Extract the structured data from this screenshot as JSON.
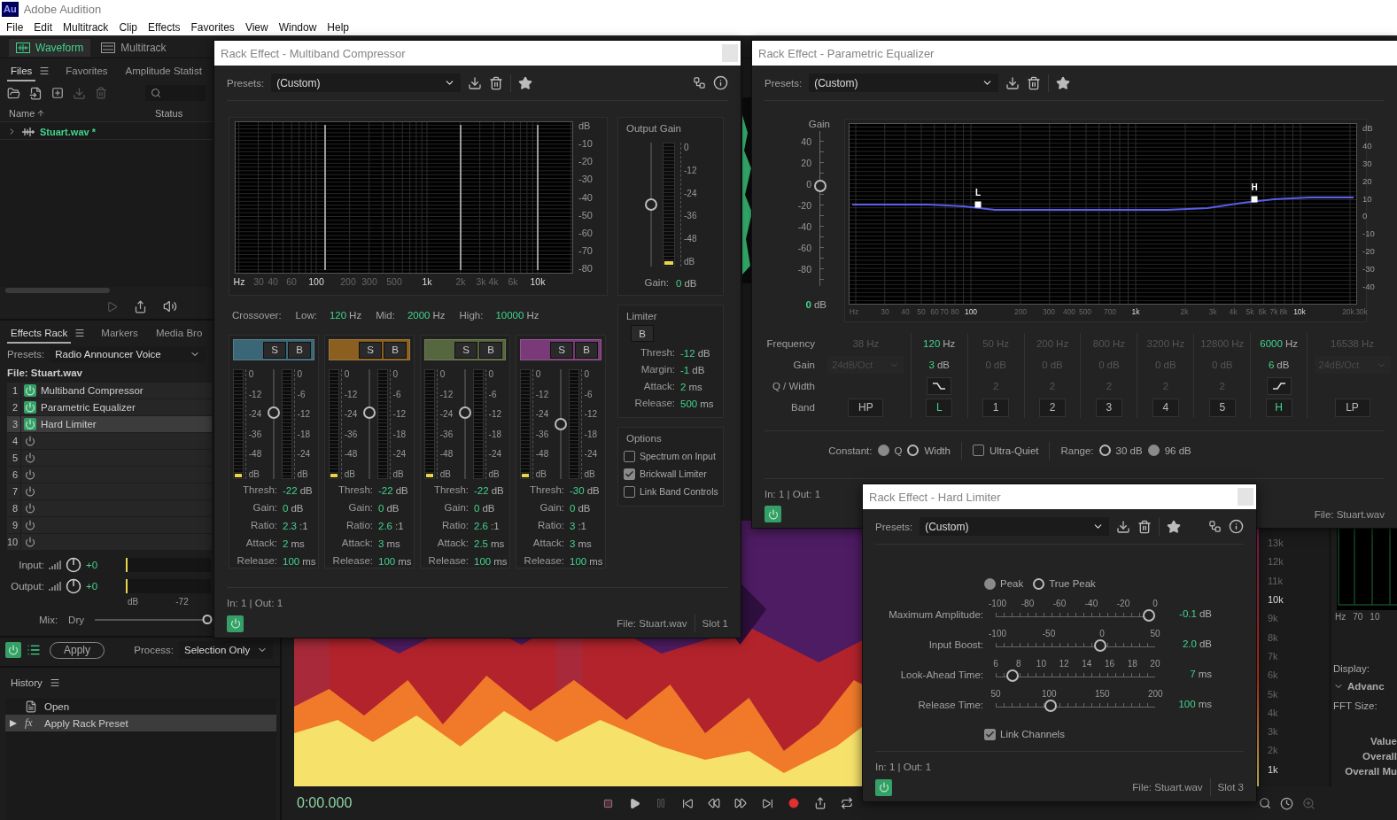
{
  "app": {
    "logo": "Au",
    "title": "Adobe Audition"
  },
  "menu": [
    "File",
    "Edit",
    "Multitrack",
    "Clip",
    "Effects",
    "Favorites",
    "View",
    "Window",
    "Help"
  ],
  "workspace_tabs": [
    {
      "label": "Waveform",
      "selected": true
    },
    {
      "label": "Multitrack",
      "selected": false
    }
  ],
  "files_panel": {
    "tabs": [
      {
        "label": "Files",
        "selected": true
      },
      {
        "label": "Favorites",
        "selected": false
      },
      {
        "label": "Amplitude Statist",
        "selected": false
      }
    ],
    "columns": [
      "Name",
      "Status"
    ],
    "files": [
      {
        "name": "Stuart.wav *",
        "expanded": false
      }
    ]
  },
  "effects_rack": {
    "tabs": [
      {
        "label": "Effects Rack",
        "selected": true
      },
      {
        "label": "Markers",
        "selected": false
      },
      {
        "label": "Media Bro",
        "selected": false
      }
    ],
    "presets_label": "Presets:",
    "preset": "Radio Announcer Voice",
    "file": "File: Stuart.wav",
    "slots": [
      {
        "number": "1",
        "name": "Multiband Compressor",
        "on": true,
        "selected": false
      },
      {
        "number": "2",
        "name": "Parametric Equalizer",
        "on": true,
        "selected": false
      },
      {
        "number": "3",
        "name": "Hard Limiter",
        "on": true,
        "selected": true
      },
      {
        "number": "4",
        "on": false,
        "selected": false
      },
      {
        "number": "5",
        "on": false,
        "selected": false
      },
      {
        "number": "6",
        "on": false,
        "selected": false
      },
      {
        "number": "7",
        "on": false,
        "selected": false
      },
      {
        "number": "8",
        "on": false,
        "selected": false
      },
      {
        "number": "9",
        "on": false,
        "selected": false
      },
      {
        "number": "10",
        "on": false,
        "selected": false
      }
    ],
    "io": [
      {
        "label": "Input:",
        "value": "+0"
      },
      {
        "label": "Output:",
        "value": "+0"
      }
    ],
    "meter_scale": [
      "dB",
      "-72"
    ],
    "mix": {
      "label": "Mix:",
      "left": "Dry",
      "level": 1
    },
    "apply": "Apply",
    "process_label": "Process:",
    "process": "Selection Only"
  },
  "history": {
    "title": "History",
    "items": [
      {
        "label": "Open",
        "selected": false
      },
      {
        "label": "Apply Rack Preset",
        "badge": "fx",
        "selected": true
      }
    ]
  },
  "editor": {
    "time": "0:00.000",
    "frequency_labels": [
      {
        "label": "13k",
        "major": false
      },
      {
        "label": "12k",
        "major": false
      },
      {
        "label": "11k",
        "major": false
      },
      {
        "label": "10k",
        "major": true
      },
      {
        "label": "9k",
        "major": false
      },
      {
        "label": "8k",
        "major": false
      },
      {
        "label": "7k",
        "major": false
      },
      {
        "label": "6k",
        "major": false
      },
      {
        "label": "5k",
        "major": false
      },
      {
        "label": "4k",
        "major": false
      },
      {
        "label": "3k",
        "major": false
      },
      {
        "label": "2k",
        "major": false
      },
      {
        "label": "1k",
        "major": true
      }
    ],
    "right_panel": {
      "axis": [
        "Hz",
        "70",
        "10"
      ],
      "display_label": "Display:",
      "advanced": "Advanc",
      "fft_label": "FFT Size:",
      "labels": [
        "Value",
        "Overall",
        "Overall Mu"
      ]
    }
  },
  "multiband_compressor": {
    "title": "Rack Effect - Multiband Compressor",
    "presets_label": "Presets:",
    "preset": "(Custom)",
    "spectrum": {
      "db_labels": [
        "dB",
        "-10",
        "-20",
        "-30",
        "-40",
        "-50",
        "-60",
        "-70",
        "-80"
      ],
      "hz_labels": [
        {
          "label": "Hz",
          "major": true
        },
        {
          "label": "30",
          "major": false
        },
        {
          "label": "40",
          "major": false
        },
        {
          "label": "60",
          "major": false
        },
        {
          "label": "100",
          "major": true
        },
        {
          "label": "200",
          "major": false
        },
        {
          "label": "300",
          "major": false
        },
        {
          "label": "500",
          "major": false
        },
        {
          "label": "1k",
          "major": true
        },
        {
          "label": "2k",
          "major": false
        },
        {
          "label": "3k",
          "major": false
        },
        {
          "label": "4k",
          "major": false
        },
        {
          "label": "6k",
          "major": false
        },
        {
          "label": "10k",
          "major": true
        }
      ]
    },
    "output_gain": {
      "title": "Output Gain",
      "scale": [
        "0",
        "-12",
        "-24",
        "-36",
        "-48",
        "dB"
      ],
      "level": 0.5,
      "meter": {
        "level": 0.03
      },
      "gain_label": "Gain:",
      "gain": "0",
      "unit": "dB"
    },
    "crossover": {
      "label": "Crossover:",
      "points": [
        {
          "label": "Low:",
          "value": "120",
          "unit": "Hz"
        },
        {
          "label": "Mid:",
          "value": "2000",
          "unit": "Hz"
        },
        {
          "label": "High:",
          "value": "10000",
          "unit": "Hz"
        }
      ]
    },
    "bands": [
      {
        "color": "#3b6676",
        "solo": "S",
        "bypass": "B",
        "level": 0.62,
        "meter": {
          "level": 0.03
        },
        "input_scale": [
          "0",
          "-12",
          "-24",
          "-36",
          "-48",
          "dB"
        ],
        "gain_scale": [
          "0",
          "-6",
          "-12",
          "-18",
          "-24",
          "dB"
        ],
        "params": [
          {
            "label": "Thresh:",
            "value": "-22",
            "unit": "dB"
          },
          {
            "label": "Gain:",
            "value": "0",
            "unit": "dB"
          },
          {
            "label": "Ratio:",
            "value": "2.3",
            "unit": ":1"
          },
          {
            "label": "Attack:",
            "value": "2",
            "unit": "ms"
          },
          {
            "label": "Release:",
            "value": "100",
            "unit": "ms"
          }
        ]
      },
      {
        "color": "#8a5f1f",
        "solo": "S",
        "bypass": "B",
        "level": 0.62,
        "meter": {
          "level": 0.03
        },
        "input_scale": [
          "0",
          "-12",
          "-24",
          "-36",
          "-48",
          "dB"
        ],
        "gain_scale": [
          "0",
          "-6",
          "-12",
          "-18",
          "-24",
          "dB"
        ],
        "params": [
          {
            "label": "Thresh:",
            "value": "-22",
            "unit": "dB"
          },
          {
            "label": "Gain:",
            "value": "0",
            "unit": "dB"
          },
          {
            "label": "Ratio:",
            "value": "2.6",
            "unit": ":1"
          },
          {
            "label": "Attack:",
            "value": "3",
            "unit": "ms"
          },
          {
            "label": "Release:",
            "value": "100",
            "unit": "ms"
          }
        ]
      },
      {
        "color": "#56663f",
        "solo": "S",
        "bypass": "B",
        "level": 0.62,
        "meter": {
          "level": 0.03
        },
        "input_scale": [
          "0",
          "-12",
          "-24",
          "-36",
          "-48",
          "dB"
        ],
        "gain_scale": [
          "0",
          "-6",
          "-12",
          "-18",
          "-24",
          "dB"
        ],
        "params": [
          {
            "label": "Thresh:",
            "value": "-22",
            "unit": "dB"
          },
          {
            "label": "Gain:",
            "value": "0",
            "unit": "dB"
          },
          {
            "label": "Ratio:",
            "value": "2.6",
            "unit": ":1"
          },
          {
            "label": "Attack:",
            "value": "2.5",
            "unit": "ms"
          },
          {
            "label": "Release:",
            "value": "100",
            "unit": "ms"
          }
        ]
      },
      {
        "color": "#7a3a79",
        "solo": "S",
        "bypass": "B",
        "level": 0.5,
        "meter": {
          "level": 0.03
        },
        "input_scale": [
          "0",
          "-12",
          "-24",
          "-36",
          "-48",
          "dB"
        ],
        "gain_scale": [
          "0",
          "-6",
          "-12",
          "-18",
          "-24",
          "dB"
        ],
        "params": [
          {
            "label": "Thresh:",
            "value": "-30",
            "unit": "dB"
          },
          {
            "label": "Gain:",
            "value": "0",
            "unit": "dB"
          },
          {
            "label": "Ratio:",
            "value": "3",
            "unit": ":1"
          },
          {
            "label": "Attack:",
            "value": "3",
            "unit": "ms"
          },
          {
            "label": "Release:",
            "value": "100",
            "unit": "ms"
          }
        ]
      }
    ],
    "limiter": {
      "title": "Limiter",
      "bypass": "B",
      "params": [
        {
          "label": "Thresh:",
          "value": "-12",
          "unit": "dB"
        },
        {
          "label": "Margin:",
          "value": "-1",
          "unit": "dB"
        },
        {
          "label": "Attack:",
          "value": "2",
          "unit": "ms"
        },
        {
          "label": "Release:",
          "value": "500",
          "unit": "ms"
        }
      ]
    },
    "options": {
      "title": "Options",
      "items": [
        {
          "label": "Spectrum on Input",
          "checked": false
        },
        {
          "label": "Brickwall Limiter",
          "checked": true
        },
        {
          "label": "Link Band Controls",
          "checked": false
        }
      ]
    },
    "footer": {
      "io": "In: 1 | Out: 1",
      "power": true,
      "file": "File: Stuart.wav",
      "slot": "Slot 1"
    }
  },
  "parametric_equalizer": {
    "title": "Rack Effect - Parametric Equalizer",
    "presets_label": "Presets:",
    "preset": "(Custom)",
    "gain_axis": {
      "title": "Gain",
      "labels": [
        "40",
        "20",
        "0",
        "-20",
        "-40",
        "-60",
        "-80"
      ],
      "level": 0.66,
      "value": "0",
      "unit": "dB"
    },
    "graph": {
      "db_labels": [
        "dB",
        "40",
        "30",
        "20",
        "10",
        "0",
        "-10",
        "-20",
        "-30",
        "-40"
      ],
      "hz_labels": [
        {
          "label": "Hz",
          "major": false
        },
        {
          "label": "30",
          "major": false
        },
        {
          "label": "40",
          "major": false
        },
        {
          "label": "50",
          "major": false
        },
        {
          "label": "60",
          "major": false
        },
        {
          "label": "70",
          "major": false
        },
        {
          "label": "80",
          "major": false
        },
        {
          "label": "100",
          "major": true
        },
        {
          "label": "200",
          "major": false
        },
        {
          "label": "300",
          "major": false
        },
        {
          "label": "400",
          "major": false
        },
        {
          "label": "500",
          "major": false
        },
        {
          "label": "700",
          "major": false
        },
        {
          "label": "1k",
          "major": true
        },
        {
          "label": "2k",
          "major": false
        },
        {
          "label": "3k",
          "major": false
        },
        {
          "label": "4k",
          "major": false
        },
        {
          "label": "5k",
          "major": false
        },
        {
          "label": "6k",
          "major": false
        },
        {
          "label": "7k",
          "major": false
        },
        {
          "label": "8k",
          "major": false
        },
        {
          "label": "10k",
          "major": true
        },
        {
          "label": "20k",
          "major": false
        },
        {
          "label": "30k",
          "major": false
        }
      ],
      "markers": [
        "L",
        "H"
      ]
    },
    "row_labels": [
      "Frequency",
      "Gain",
      "Q / Width",
      "Band"
    ],
    "bands": [
      {
        "kind": "pass",
        "frequency": "38",
        "unit": "Hz",
        "slope": "24dB/Oct",
        "button": "HP",
        "enabled": false
      },
      {
        "kind": "low_shelf",
        "frequency": "120",
        "unit": "Hz",
        "gain": "3",
        "gain_unit": "dB",
        "button": "L",
        "enabled": true
      },
      {
        "kind": "peak",
        "frequency": "50",
        "unit": "Hz",
        "gain": "0",
        "gain_unit": "dB",
        "q": "2",
        "button": "1",
        "enabled": false
      },
      {
        "kind": "peak",
        "frequency": "200",
        "unit": "Hz",
        "gain": "0",
        "gain_unit": "dB",
        "q": "2",
        "button": "2",
        "enabled": false
      },
      {
        "kind": "peak",
        "frequency": "800",
        "unit": "Hz",
        "gain": "0",
        "gain_unit": "dB",
        "q": "2",
        "button": "3",
        "enabled": false
      },
      {
        "kind": "peak",
        "frequency": "3200",
        "unit": "Hz",
        "gain": "0",
        "gain_unit": "dB",
        "q": "2",
        "button": "4",
        "enabled": false
      },
      {
        "kind": "peak",
        "frequency": "12800",
        "unit": "Hz",
        "gain": "0",
        "gain_unit": "dB",
        "q": "2",
        "button": "5",
        "enabled": false
      },
      {
        "kind": "high_shelf",
        "frequency": "6000",
        "unit": "Hz",
        "gain": "6",
        "gain_unit": "dB",
        "button": "H",
        "enabled": true
      },
      {
        "kind": "pass",
        "frequency": "16538",
        "unit": "Hz",
        "slope": "24dB/Oct",
        "button": "LP",
        "enabled": false
      }
    ],
    "constant": {
      "label": "Constant:",
      "options": [
        {
          "label": "Q",
          "selected": true
        },
        {
          "label": "Width",
          "selected": false
        }
      ]
    },
    "ultra_quiet": {
      "label": "Ultra-Quiet",
      "checked": false
    },
    "range": {
      "label": "Range:",
      "options": [
        {
          "label": "30 dB",
          "selected": false
        },
        {
          "label": "96 dB",
          "selected": true
        }
      ]
    },
    "footer": {
      "io": "In: 1 | Out: 1",
      "power": true,
      "file": "File: Stuart.wav"
    }
  },
  "hard_limiter": {
    "title": "Rack Effect - Hard Limiter",
    "presets_label": "Presets:",
    "preset": "(Custom)",
    "modes": [
      {
        "label": "Peak",
        "selected": true
      },
      {
        "label": "True Peak",
        "selected": false
      }
    ],
    "sliders": [
      {
        "label": "Maximum Amplitude:",
        "ticks": [
          "-100",
          "-80",
          "-60",
          "-40",
          "-20",
          "0"
        ],
        "level": 1,
        "value": "-0.1",
        "unit": "dB"
      },
      {
        "label": "Input Boost:",
        "ticks": [
          "-100",
          "-50",
          "0",
          "50"
        ],
        "level": 0.667,
        "value": "2.0",
        "unit": "dB"
      },
      {
        "label": "Look-Ahead Time:",
        "ticks": [
          "6",
          "8",
          "10",
          "12",
          "14",
          "16",
          "18",
          "20"
        ],
        "level": 0.07,
        "value": "7",
        "unit": "ms"
      },
      {
        "label": "Release Time:",
        "ticks": [
          "50",
          "100",
          "150",
          "200"
        ],
        "level": 0.333,
        "value": "100",
        "unit": "ms"
      }
    ],
    "link_channels": {
      "label": "Link Channels",
      "checked": true
    },
    "footer": {
      "io": "In: 1 | Out: 1",
      "power": true,
      "file": "File: Stuart.wav",
      "slot": "Slot 3"
    }
  }
}
